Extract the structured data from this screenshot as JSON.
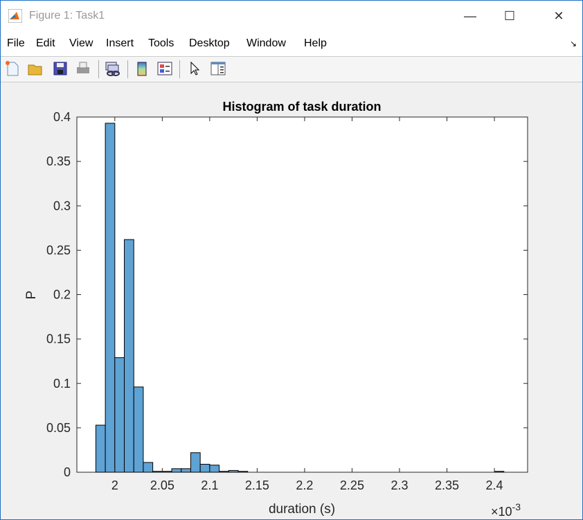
{
  "window": {
    "title": "Figure 1: Task1",
    "minimize": "—",
    "maximize": "☐",
    "close": "✕"
  },
  "menu": [
    "File",
    "Edit",
    "View",
    "Insert",
    "Tools",
    "Desktop",
    "Window",
    "Help"
  ],
  "toolbar": [
    "new-figure",
    "open-file",
    "save",
    "print",
    "link-plot",
    "insert-colorbar",
    "insert-legend",
    "edit-plot",
    "show-plot-browser"
  ],
  "colors": {
    "bar": "#5fa2d4",
    "edge": "#000000"
  },
  "chart_data": {
    "type": "bar",
    "title": "Histogram of task duration",
    "xlabel": "duration (s)",
    "ylabel": "P",
    "x_exponent": "×10",
    "x_exponent_power": "-3",
    "xlim": [
      1.96,
      2.435
    ],
    "ylim": [
      0,
      0.4
    ],
    "xticks": [
      2,
      2.05,
      2.1,
      2.15,
      2.2,
      2.25,
      2.3,
      2.35,
      2.4
    ],
    "xtick_labels": [
      "2",
      "2.05",
      "2.1",
      "2.15",
      "2.2",
      "2.25",
      "2.3",
      "2.35",
      "2.4"
    ],
    "yticks": [
      0,
      0.05,
      0.1,
      0.15,
      0.2,
      0.25,
      0.3,
      0.35,
      0.4
    ],
    "ytick_labels": [
      "0",
      "0.05",
      "0.1",
      "0.15",
      "0.2",
      "0.25",
      "0.3",
      "0.35",
      "0.4"
    ],
    "bin_width": 0.01,
    "bin_edges_start": [
      1.98,
      1.99,
      2.0,
      2.01,
      2.02,
      2.03,
      2.04,
      2.05,
      2.06,
      2.07,
      2.08,
      2.09,
      2.1,
      2.11,
      2.12,
      2.13,
      2.4
    ],
    "values": [
      0.053,
      0.393,
      0.129,
      0.262,
      0.096,
      0.011,
      0.001,
      0.001,
      0.004,
      0.004,
      0.022,
      0.009,
      0.008,
      0.001,
      0.002,
      0.001,
      0.001
    ]
  }
}
